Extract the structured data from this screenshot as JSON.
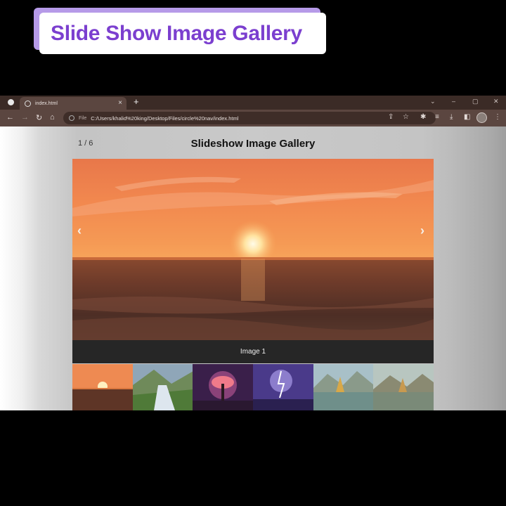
{
  "overlay": {
    "title": "Slide Show Image Gallery"
  },
  "browser": {
    "tab_title": "index.html",
    "tab_close": "×",
    "new_tab": "+",
    "window_controls": [
      "⌄",
      "–",
      "▢",
      "✕"
    ],
    "file_label": "File",
    "url": "C:/Users/khalid%20king/Desktop/Files/circle%20nav/index.html"
  },
  "gallery": {
    "counter": "1 / 6",
    "heading": "Slideshow Image Gallery",
    "prev_arrow": "‹",
    "next_arrow": "›",
    "caption": "Image 1",
    "thumbnails": [
      "sunset-sea",
      "waterfall-meadow",
      "glowing-tree-night",
      "purple-lightning",
      "mountain-lake",
      "mountain-lake-reflection"
    ]
  },
  "colors": {
    "accent": "#7b3fcf",
    "title_shadow": "#b69ae8",
    "caption_bg": "#262626"
  }
}
